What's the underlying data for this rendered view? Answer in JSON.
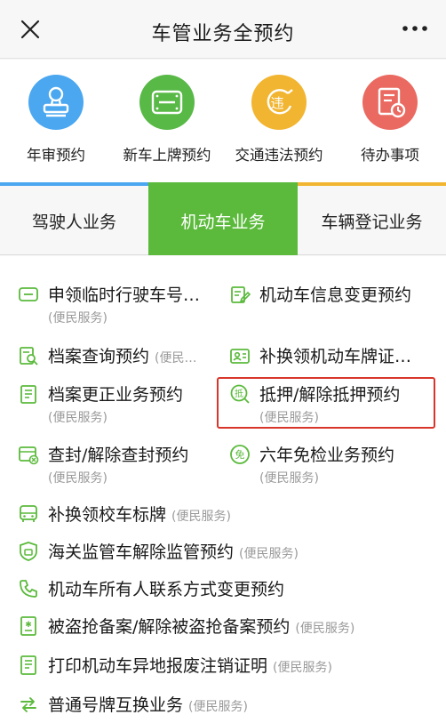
{
  "header": {
    "title": "车管业务全预约",
    "close_icon": "close-icon",
    "more_icon": "more-dots-icon"
  },
  "quick_services": [
    {
      "label": "年审预约",
      "icon": "stamp-icon",
      "color": "#4aa7f0"
    },
    {
      "label": "新车上牌预约",
      "icon": "license-plate-icon",
      "color": "#58b947"
    },
    {
      "label": "交通违法预约",
      "icon": "violation-icon",
      "color": "#f2b531"
    },
    {
      "label": "待办事项",
      "icon": "todo-document-icon",
      "color": "#ea6a61"
    }
  ],
  "tabs": [
    {
      "label": "驾驶人业务",
      "stripe": "#4aa7f0"
    },
    {
      "label": "机动车业务",
      "active": true
    },
    {
      "label": "车辆登记业务",
      "stripe": "#f2b531"
    }
  ],
  "services_grid": [
    {
      "label": "申领临时行驶车号…",
      "sub": "(便民服务)",
      "icon": "temporary-plate-icon"
    },
    {
      "label": "机动车信息变更预约",
      "icon": "edit-document-icon"
    },
    {
      "label": "档案查询预约",
      "tag": "(便民…",
      "icon": "archive-search-icon"
    },
    {
      "label": "补换领机动车牌证…",
      "icon": "id-card-icon"
    },
    {
      "label": "档案更正业务预约",
      "sub": "(便民服务)",
      "icon": "document-correct-icon"
    },
    {
      "label": "抵押/解除抵押预约",
      "sub": "(便民服务)",
      "icon": "mortgage-icon",
      "icon_text": "抵"
    },
    {
      "label": "查封/解除查封预约",
      "sub": "(便民服务)",
      "icon": "seal-car-icon"
    },
    {
      "label": "六年免检业务预约",
      "sub": "(便民服务)",
      "icon": "exempt-inspection-icon",
      "icon_text": "免"
    }
  ],
  "services_list": [
    {
      "label": "补换领校车标牌",
      "tag": "(便民服务)",
      "icon": "school-bus-icon"
    },
    {
      "label": "海关监管车解除监管预约",
      "tag": "(便民服务)",
      "icon": "customs-shield-icon"
    },
    {
      "label": "机动车所有人联系方式变更预约",
      "icon": "phone-icon"
    },
    {
      "label": "被盗抢备案/解除被盗抢备案预约",
      "tag": "(便民服务)",
      "icon": "theft-record-icon"
    },
    {
      "label": "打印机动车异地报废注销证明",
      "tag": "(便民服务)",
      "icon": "print-document-icon"
    },
    {
      "label": "普通号牌互换业务",
      "tag": "(便民服务)",
      "icon": "swap-arrows-icon"
    }
  ],
  "highlight_color": "#d9362b",
  "accent_green": "#5bba3c"
}
